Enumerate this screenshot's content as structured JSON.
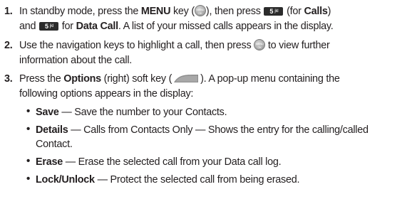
{
  "steps": [
    {
      "number": "1.",
      "line1": {
        "t1": "In standby mode, press the ",
        "b1": "MENU",
        "t2": " key (",
        "t3": "), then press ",
        "t4": " (for ",
        "b2": "Calls",
        "t5": ")"
      },
      "line2": {
        "t1": "and ",
        "t2": " for ",
        "b1": "Data Call",
        "t3": ". A list of your missed calls appears in the display."
      }
    },
    {
      "number": "2.",
      "line1": {
        "t1": "Use the navigation keys to highlight a call, then press ",
        "t2": " to view further"
      },
      "line2": "information about the call."
    },
    {
      "number": "3.",
      "line1": {
        "t1": "Press the ",
        "b1": "Options",
        "t2": " (right) soft key (",
        "t3": "). A pop-up menu containing the"
      },
      "line2": "following options appears in the display:"
    }
  ],
  "key_glyphs": {
    "menu_top": "MENU",
    "menu_bottom": "OK",
    "five": "5",
    "five_letters": "jkl"
  },
  "options": [
    {
      "term": "Save",
      "desc": " — Save the number to your Contacts."
    },
    {
      "term": "Details",
      "desc": " — Calls from Contacts Only — Shows the entry for the calling/called",
      "desc2": "Contact."
    },
    {
      "term": "Erase",
      "desc": " — Erase the selected call from your Data call log."
    },
    {
      "term": "Lock/Unlock",
      "desc": " — Protect the selected call from being erased."
    }
  ],
  "bullet_char": "•"
}
